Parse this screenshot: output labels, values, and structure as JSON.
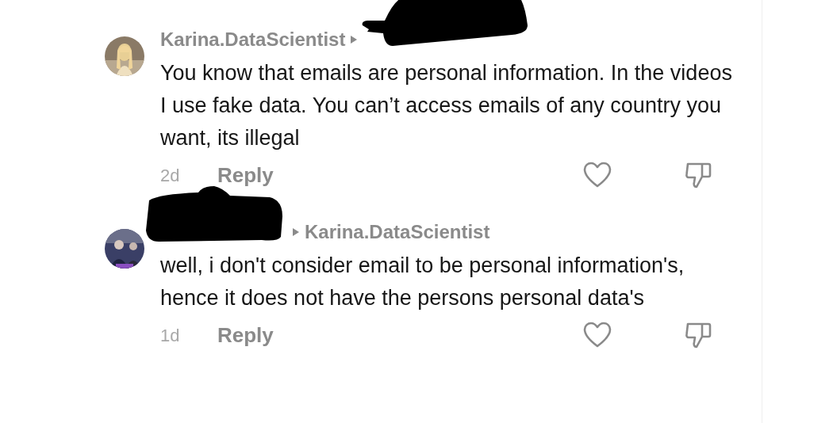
{
  "comments": [
    {
      "username": "Karina.DataScientist",
      "reply_to_redacted": true,
      "text": "You know that emails are personal information. In the videos I use fake data. You can’t access emails of any country you want, its illegal",
      "age": "2d",
      "reply_label": "Reply"
    },
    {
      "username_redacted": true,
      "reply_to": "Karina.DataScientist",
      "text": "well, i don't consider email to be personal information's, hence it does not have the persons personal data's",
      "age": "1d",
      "reply_label": "Reply"
    }
  ]
}
